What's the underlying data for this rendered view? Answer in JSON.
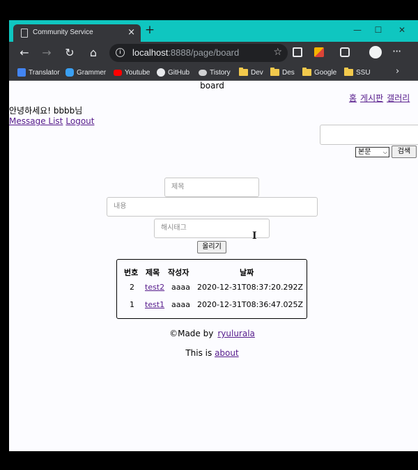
{
  "browser": {
    "tab_title": "Community Service",
    "url_host": "localhost",
    "url_rest": ":8888/page/board",
    "bookmarks": [
      "Translator",
      "Grammer",
      "Youtube",
      "GitHub",
      "Tistory",
      "Dev",
      "Des",
      "Google",
      "SSU"
    ]
  },
  "page": {
    "heading": "board",
    "nav": [
      "홈",
      "게시판",
      "갤러리"
    ],
    "greeting": "안녕하세요! bbbb님",
    "user_links": [
      "Message List",
      "Logout"
    ],
    "search": {
      "input_value": "",
      "select_value": "본문",
      "button_label": "검색"
    },
    "form": {
      "title_placeholder": "제목",
      "content_placeholder": "내용",
      "hashtag_placeholder": "해시태그",
      "submit_label": "올리기"
    },
    "table": {
      "headers": [
        "번호",
        "제목",
        "작성자",
        "날짜"
      ],
      "rows": [
        {
          "no": "2",
          "title": "test2",
          "author": "aaaa",
          "date": "2020-12-31T08:37:20.292Z"
        },
        {
          "no": "1",
          "title": "test1",
          "author": "aaaa",
          "date": "2020-12-31T08:36:47.025Z"
        }
      ]
    },
    "footer": {
      "made_by_prefix": "©Made by",
      "made_by_link": "ryulurala",
      "about_prefix": "This is",
      "about_link": "about"
    }
  }
}
